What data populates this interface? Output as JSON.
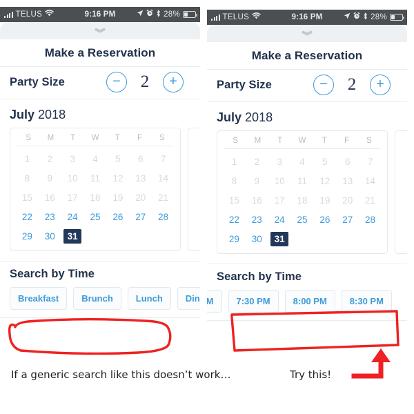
{
  "statusbar": {
    "carrier": "TELUS",
    "time": "9:16 PM",
    "battery_pct": "28%",
    "icons": [
      "signal-bars-icon",
      "wifi-icon",
      "location-arrow-icon",
      "alarm-clock-icon",
      "bluetooth-icon",
      "battery-icon"
    ]
  },
  "sheet": {
    "title": "Make a Reservation",
    "grabber_icon": "chevron-down-icon"
  },
  "party": {
    "label": "Party Size",
    "decrement_label": "−",
    "increment_label": "+",
    "count": "2"
  },
  "calendar": {
    "month": "July",
    "year": "2018",
    "dow": [
      "S",
      "M",
      "T",
      "W",
      "T",
      "F",
      "S"
    ],
    "days": [
      {
        "n": "1",
        "state": "past"
      },
      {
        "n": "2",
        "state": "past"
      },
      {
        "n": "3",
        "state": "past"
      },
      {
        "n": "4",
        "state": "past"
      },
      {
        "n": "5",
        "state": "past"
      },
      {
        "n": "6",
        "state": "past"
      },
      {
        "n": "7",
        "state": "past"
      },
      {
        "n": "8",
        "state": "past"
      },
      {
        "n": "9",
        "state": "past"
      },
      {
        "n": "10",
        "state": "past"
      },
      {
        "n": "11",
        "state": "past"
      },
      {
        "n": "12",
        "state": "past"
      },
      {
        "n": "13",
        "state": "past"
      },
      {
        "n": "14",
        "state": "past"
      },
      {
        "n": "15",
        "state": "past"
      },
      {
        "n": "16",
        "state": "past"
      },
      {
        "n": "17",
        "state": "past"
      },
      {
        "n": "18",
        "state": "past"
      },
      {
        "n": "19",
        "state": "past"
      },
      {
        "n": "20",
        "state": "past"
      },
      {
        "n": "21",
        "state": "past"
      },
      {
        "n": "22",
        "state": "avail"
      },
      {
        "n": "23",
        "state": "avail"
      },
      {
        "n": "24",
        "state": "avail"
      },
      {
        "n": "25",
        "state": "avail"
      },
      {
        "n": "26",
        "state": "avail"
      },
      {
        "n": "27",
        "state": "avail"
      },
      {
        "n": "28",
        "state": "avail"
      },
      {
        "n": "29",
        "state": "avail"
      },
      {
        "n": "30",
        "state": "avail"
      },
      {
        "n": "31",
        "state": "selected"
      }
    ]
  },
  "search_time": {
    "title": "Search by Time",
    "chips_left": [
      "Breakfast",
      "Brunch",
      "Lunch",
      "Din"
    ],
    "chips_right": [
      "PM",
      "7:30 PM",
      "8:00 PM",
      "8:30 PM"
    ]
  },
  "captions": {
    "left": "If a generic search like this doesn’t work…",
    "right": "Try this!"
  },
  "annotations": {
    "left_shape": "red-oval-highlight",
    "right_shape": "red-rectangle-highlight",
    "arrow": "red-arrow-up"
  },
  "colors": {
    "navy": "#22385a",
    "blue": "#3d9ad9",
    "annotation_red": "#ee2222",
    "statusbar_bg": "#4b4f52",
    "muted": "#d6dade"
  }
}
